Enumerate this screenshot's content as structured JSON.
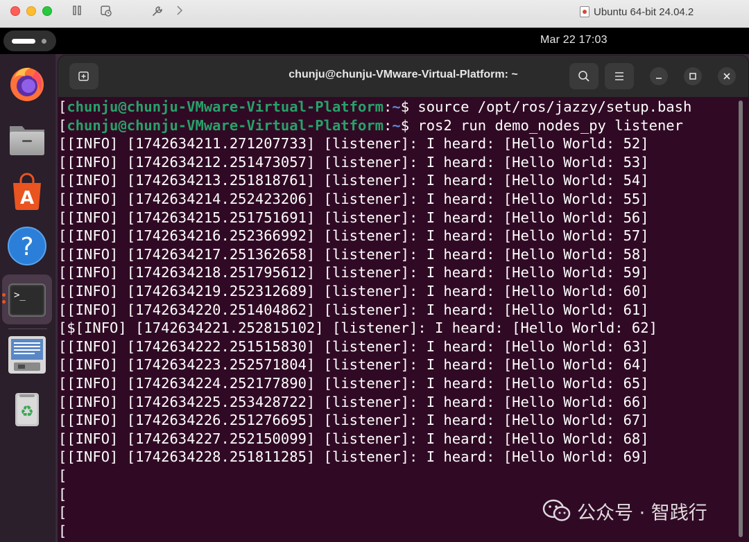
{
  "mac": {
    "window_title": "Ubuntu 64-bit 24.04.2"
  },
  "panel": {
    "clock": "Mar 22  17:03"
  },
  "dock": {
    "items": [
      "firefox-icon",
      "files-icon",
      "app-center-icon",
      "help-icon",
      "terminal-icon",
      "text-editor-icon",
      "trash-icon"
    ]
  },
  "terminal": {
    "title": "chunju@chunju-VMware-Virtual-Platform: ~",
    "commands": [
      {
        "user": "chunju@chunju-VMware-Virtual-Platform",
        "sep": ":",
        "path": "~",
        "sign": "$ ",
        "cmd": "source /opt/ros/jazzy/setup.bash"
      },
      {
        "user": "chunju@chunju-VMware-Virtual-Platform",
        "sep": ":",
        "path": "~",
        "sign": "$ ",
        "cmd": "ros2 run demo_nodes_py listener"
      }
    ],
    "log_lines": [
      "[INFO] [1742634211.271207733] [listener]: I heard: [Hello World: 52]",
      "[INFO] [1742634212.251473057] [listener]: I heard: [Hello World: 53]",
      "[INFO] [1742634213.251818761] [listener]: I heard: [Hello World: 54]",
      "[INFO] [1742634214.252423206] [listener]: I heard: [Hello World: 55]",
      "[INFO] [1742634215.251751691] [listener]: I heard: [Hello World: 56]",
      "[INFO] [1742634216.252366992] [listener]: I heard: [Hello World: 57]",
      "[INFO] [1742634217.251362658] [listener]: I heard: [Hello World: 58]",
      "[INFO] [1742634218.251795612] [listener]: I heard: [Hello World: 59]",
      "[INFO] [1742634219.252312689] [listener]: I heard: [Hello World: 60]",
      "[INFO] [1742634220.251404862] [listener]: I heard: [Hello World: 61]",
      "$[INFO] [1742634221.252815102] [listener]: I heard: [Hello World: 62]",
      "[INFO] [1742634222.251515830] [listener]: I heard: [Hello World: 63]",
      "[INFO] [1742634223.252571804] [listener]: I heard: [Hello World: 64]",
      "[INFO] [1742634224.252177890] [listener]: I heard: [Hello World: 65]",
      "[INFO] [1742634225.253428722] [listener]: I heard: [Hello World: 66]",
      "[INFO] [1742634226.251276695] [listener]: I heard: [Hello World: 67]",
      "[INFO] [1742634227.252150099] [listener]: I heard: [Hello World: 68]",
      "[INFO] [1742634228.251811285] [listener]: I heard: [Hello World: 69]"
    ]
  },
  "watermark": {
    "text": "公众号 · 智践行"
  }
}
